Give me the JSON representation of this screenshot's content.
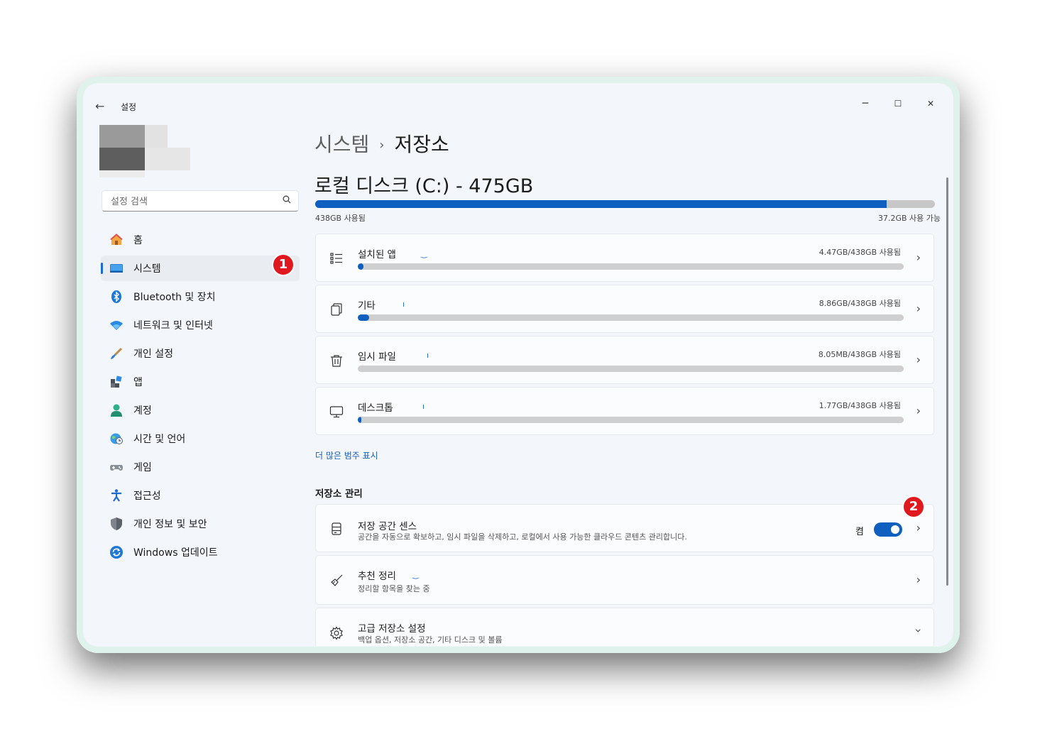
{
  "titlebar": {
    "back_icon": "arrow-left-icon",
    "app_title": "설정",
    "minimize": "─",
    "maximize": "☐",
    "close": "✕"
  },
  "search": {
    "placeholder": "설정 검색",
    "icon": "search-icon"
  },
  "nav": {
    "items": [
      {
        "label": "홈",
        "icon": "home-icon"
      },
      {
        "label": "시스템",
        "icon": "system-display-icon",
        "active": true
      },
      {
        "label": "Bluetooth 및 장치",
        "icon": "bluetooth-icon"
      },
      {
        "label": "네트워크 및 인터넷",
        "icon": "wifi-icon"
      },
      {
        "label": "개인 설정",
        "icon": "paintbrush-icon"
      },
      {
        "label": "앱",
        "icon": "apps-icon"
      },
      {
        "label": "계정",
        "icon": "account-icon"
      },
      {
        "label": "시간 및 언어",
        "icon": "globe-clock-icon"
      },
      {
        "label": "게임",
        "icon": "gamepad-icon"
      },
      {
        "label": "접근성",
        "icon": "accessibility-icon"
      },
      {
        "label": "개인 정보 및 보안",
        "icon": "shield-icon"
      },
      {
        "label": "Windows 업데이트",
        "icon": "update-icon"
      }
    ]
  },
  "annotations": {
    "badge1": "1",
    "badge2": "2"
  },
  "breadcrumb": {
    "parent": "시스템",
    "separator": "›",
    "current": "저장소"
  },
  "disk": {
    "title": "로컬 디스크 (C:) - 475GB",
    "used_label": "438GB 사용됨",
    "free_label": "37.2GB 사용 가능",
    "used_fraction": 0.922
  },
  "categories": [
    {
      "title": "설치된 앱",
      "size": "4.47GB/438GB 사용됨",
      "fraction": 0.0102,
      "icon": "list-icon"
    },
    {
      "title": "기타",
      "size": "8.86GB/438GB 사용됨",
      "fraction": 0.0202,
      "icon": "documents-icon"
    },
    {
      "title": "임시 파일",
      "size": "8.05MB/438GB 사용됨",
      "fraction": 0.0,
      "icon": "trash-icon"
    },
    {
      "title": "데스크톱",
      "size": "1.77GB/438GB 사용됨",
      "fraction": 0.004,
      "icon": "monitor-icon"
    }
  ],
  "more_link": "더 많은 범주 표시",
  "management": {
    "section_title": "저장소 관리",
    "storage_sense": {
      "title": "저장 공간 센스",
      "subtitle": "공간을 자동으로 확보하고, 임시 파일을 삭제하고, 로컬에서 사용 가능한 클라우드 콘텐츠 관리합니다.",
      "toggle_label": "켬",
      "toggle_on": true,
      "icon": "storage-drive-icon"
    },
    "cleanup": {
      "title": "추천 정리",
      "subtitle": "정리할 항목을 찾는 중",
      "icon": "broom-icon"
    },
    "advanced": {
      "title": "고급 저장소 설정",
      "subtitle": "백업 옵션, 저장소 공간, 기타 디스크 및 볼륨",
      "icon": "gear-icon"
    }
  },
  "colors": {
    "accent": "#0f5fc0",
    "badge": "#e0191e"
  }
}
